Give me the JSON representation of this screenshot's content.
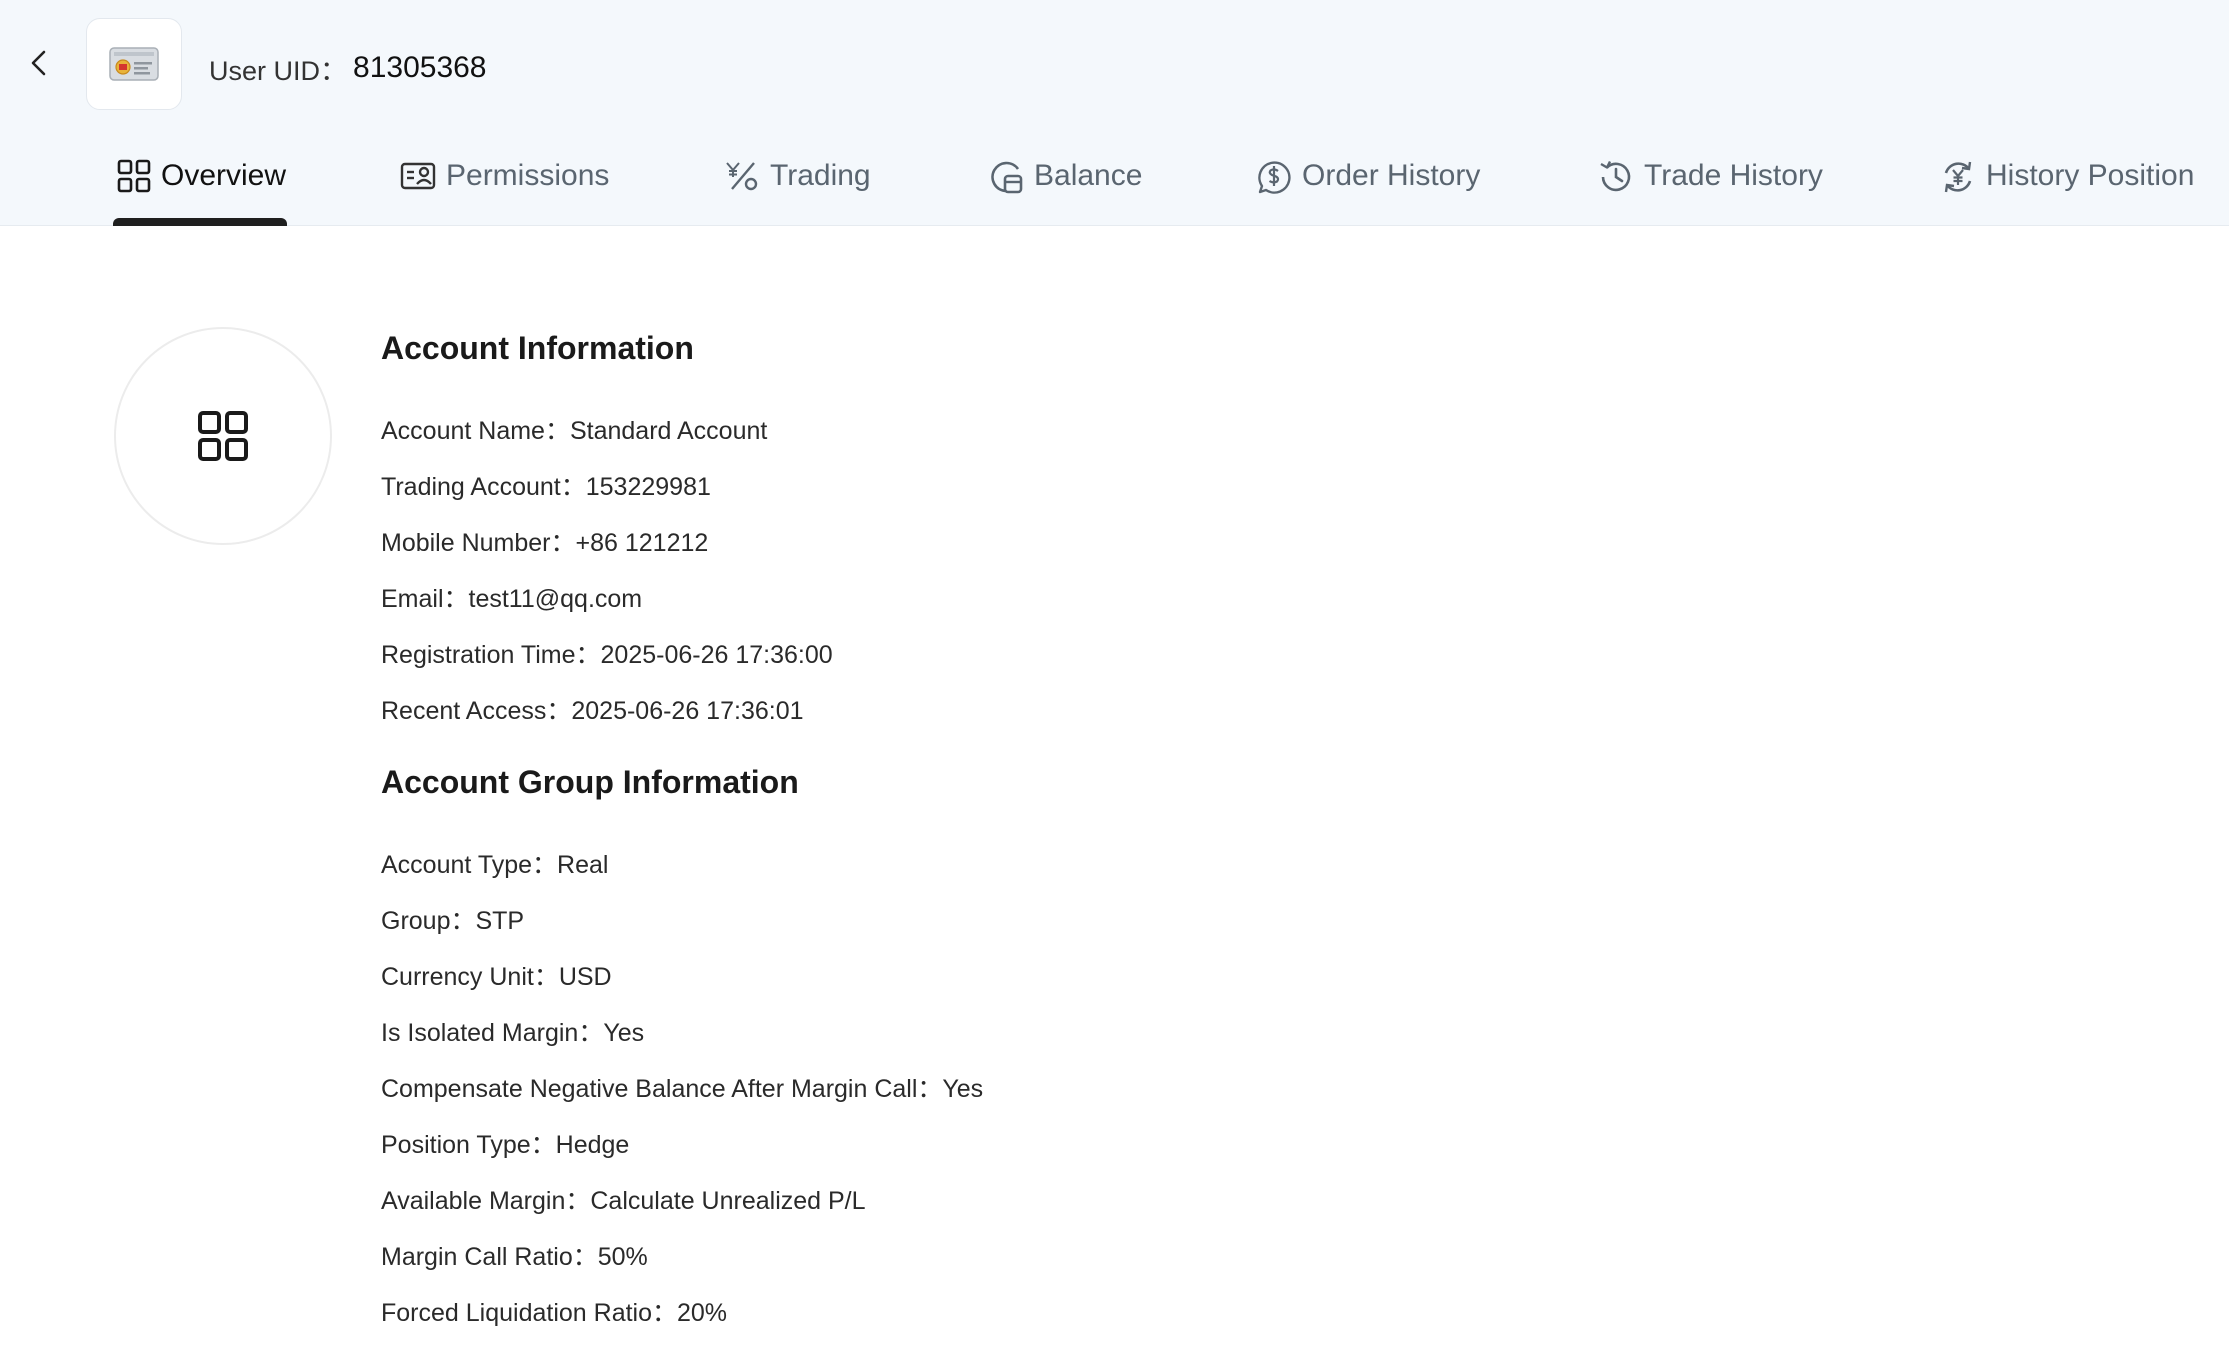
{
  "header": {
    "uid_label": "User UID：",
    "uid_value": "81305368"
  },
  "tabs": [
    {
      "label": "Overview",
      "icon": "grid-icon",
      "active": true
    },
    {
      "label": "Permissions",
      "icon": "id-card-icon",
      "active": false
    },
    {
      "label": "Trading",
      "icon": "percent-icon",
      "active": false
    },
    {
      "label": "Balance",
      "icon": "wallet-icon",
      "active": false
    },
    {
      "label": "Order History",
      "icon": "dollar-circle-icon",
      "active": false
    },
    {
      "label": "Trade History",
      "icon": "clock-history-icon",
      "active": false
    },
    {
      "label": "History Position",
      "icon": "yen-cycle-icon",
      "active": false
    }
  ],
  "account_info": {
    "title": "Account Information",
    "rows": [
      {
        "label": "Account Name：",
        "value": "Standard Account"
      },
      {
        "label": "Trading Account：",
        "value": "153229981"
      },
      {
        "label": "Mobile Number：",
        "value": "+86 121212"
      },
      {
        "label": "Email：",
        "value": "test11@qq.com"
      },
      {
        "label": "Registration Time：",
        "value": "2025-06-26 17:36:00"
      },
      {
        "label": "Recent Access：",
        "value": "2025-06-26 17:36:01"
      }
    ]
  },
  "group_info": {
    "title": "Account Group Information",
    "rows": [
      {
        "label": "Account Type：",
        "value": "Real"
      },
      {
        "label": "Group：",
        "value": "STP"
      },
      {
        "label": "Currency Unit：",
        "value": "USD"
      },
      {
        "label": "Is Isolated Margin：",
        "value": "Yes"
      },
      {
        "label": "Compensate Negative Balance After Margin Call：",
        "value": "Yes"
      },
      {
        "label": "Position Type：",
        "value": "Hedge"
      },
      {
        "label": "Available Margin：",
        "value": "Calculate Unrealized P/L"
      },
      {
        "label": "Margin Call Ratio：",
        "value": "50%"
      },
      {
        "label": "Forced Liquidation Ratio：",
        "value": "20%"
      }
    ]
  },
  "colors": {
    "header_bg": "#f4f8fc",
    "active_indicator": "#1f1f1f",
    "avatar_accent": "#e8b33a"
  }
}
